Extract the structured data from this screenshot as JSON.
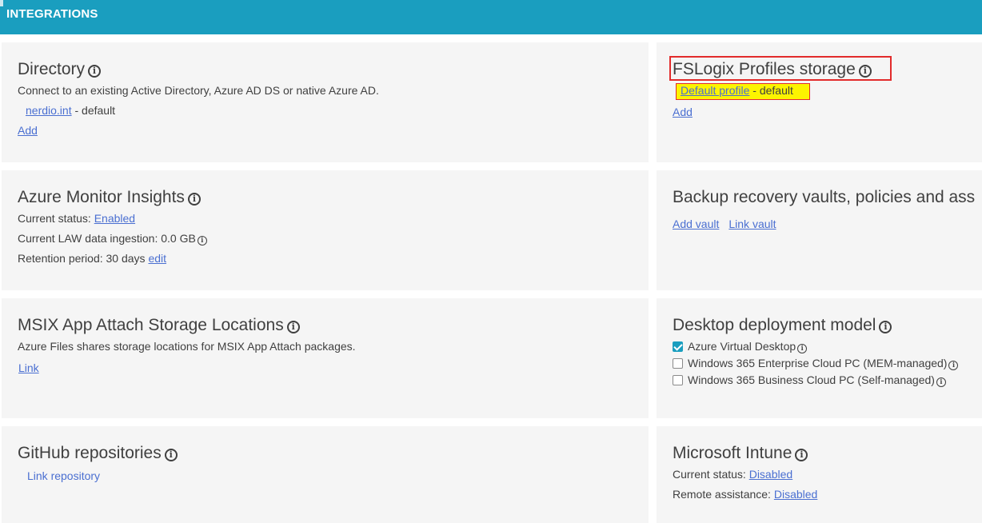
{
  "header": {
    "title": "INTEGRATIONS"
  },
  "directory": {
    "title": "Directory",
    "description": "Connect to an existing Active Directory, Azure AD DS or native Azure AD.",
    "entry_link": "nerdio.int",
    "entry_suffix": " - default",
    "add_label": "Add"
  },
  "fslogix": {
    "title": "FSLogix Profiles storage",
    "profile_link": "Default profile",
    "profile_suffix": " - default",
    "add_label": "Add"
  },
  "monitor": {
    "title": "Azure Monitor Insights",
    "status_label": "Current status: ",
    "status_value": "Enabled",
    "ingestion_text": "Current LAW data ingestion: 0.0 GB",
    "retention_text": "Retention period: 30 days ",
    "edit_label": "edit"
  },
  "backup": {
    "title": "Backup recovery vaults, policies and ass",
    "add_vault_label": "Add vault",
    "link_vault_label": "Link vault"
  },
  "msix": {
    "title": "MSIX App Attach Storage Locations",
    "description": "Azure Files shares storage locations for MSIX App Attach packages.",
    "link_label": "Link"
  },
  "deployment": {
    "title": "Desktop deployment model",
    "options": [
      {
        "label": "Azure Virtual Desktop",
        "checked": true
      },
      {
        "label": "Windows 365 Enterprise Cloud PC (MEM-managed)",
        "checked": false
      },
      {
        "label": "Windows 365 Business Cloud PC (Self-managed)",
        "checked": false
      }
    ]
  },
  "github": {
    "title": "GitHub repositories",
    "link_label": "Link repository"
  },
  "intune": {
    "title": "Microsoft Intune",
    "status_label": "Current status: ",
    "status_value": "Disabled",
    "remote_label": "Remote assistance: ",
    "remote_value": "Disabled"
  },
  "colors": {
    "header": "#1a9ebf",
    "link": "#4a6fd1",
    "highlight": "#fcf400",
    "annotation": "#e22b2b"
  }
}
